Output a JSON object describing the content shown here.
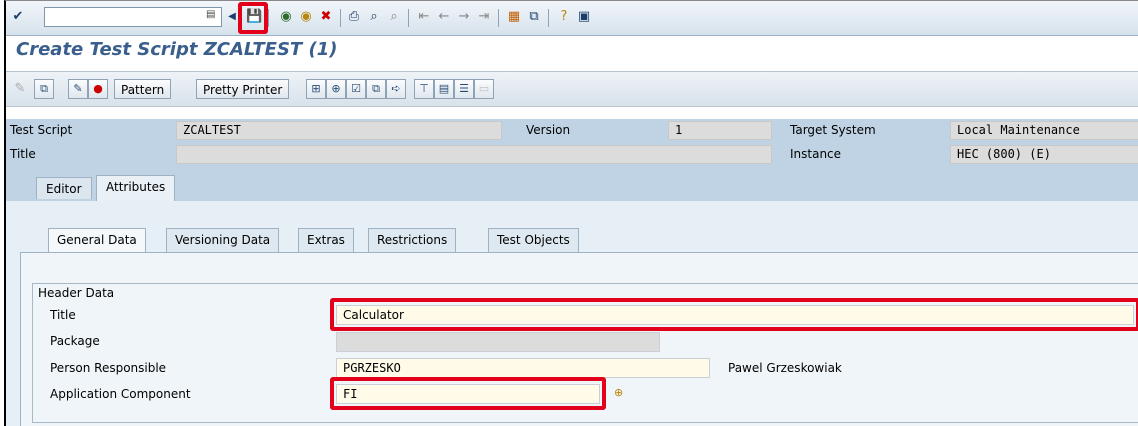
{
  "title": "Create Test Script ZCALTEST (1)",
  "toolbar": {
    "pattern_label": "Pattern",
    "pretty_printer_label": "Pretty Printer"
  },
  "header": {
    "test_script_label": "Test Script",
    "test_script_value": "ZCALTEST",
    "version_label": "Version",
    "version_value": "1",
    "target_system_label": "Target System",
    "target_system_value": "Local Maintenance",
    "title_label": "Title",
    "title_value": "",
    "instance_label": "Instance",
    "instance_value": "HEC (800) (E)"
  },
  "tabs": [
    {
      "label": "Editor"
    },
    {
      "label": "Attributes"
    }
  ],
  "subtabs": [
    {
      "label": "General Data"
    },
    {
      "label": "Versioning Data"
    },
    {
      "label": "Extras"
    },
    {
      "label": "Restrictions"
    },
    {
      "label": "Test Objects"
    }
  ],
  "header_data": {
    "group_label": "Header Data",
    "title_label": "Title",
    "title_value": "Calculator",
    "package_label": "Package",
    "package_value": "",
    "person_label": "Person Responsible",
    "person_value": "PGRZESKO",
    "person_name": "Pawel Grzeskowiak",
    "component_label": "Application Component",
    "component_value": "FI"
  },
  "colors": {
    "highlight": "#e3001b",
    "title": "#3a5f8c",
    "header_bg": "#bfd3e4"
  }
}
